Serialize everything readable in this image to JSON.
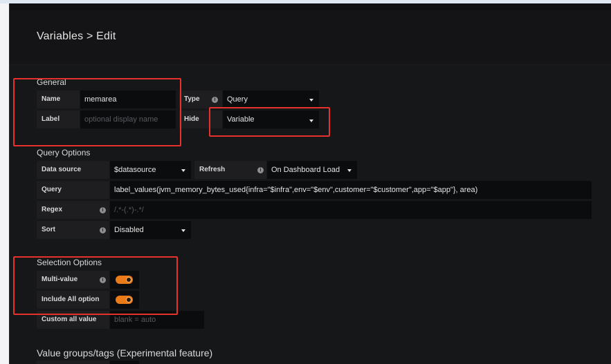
{
  "page": {
    "title": "Variables > Edit"
  },
  "general": {
    "title": "General",
    "name_label": "Name",
    "name_value": "memarea",
    "label_label": "Label",
    "label_placeholder": "optional display name",
    "type_label": "Type",
    "type_value": "Query",
    "hide_label": "Hide",
    "hide_value": "Variable"
  },
  "query_options": {
    "title": "Query Options",
    "datasource_label": "Data source",
    "datasource_value": "$datasource",
    "refresh_label": "Refresh",
    "refresh_value": "On Dashboard Load",
    "query_label": "Query",
    "query_value": "label_values(jvm_memory_bytes_used{infra=\"$infra\",env=\"$env\",customer=\"$customer\",app=\"$app\"}, area)",
    "regex_label": "Regex",
    "regex_placeholder": "/.*-(.*)-.*/",
    "sort_label": "Sort",
    "sort_value": "Disabled"
  },
  "selection_options": {
    "title": "Selection Options",
    "multi_value_label": "Multi-value",
    "multi_value_on": true,
    "include_all_label": "Include All option",
    "include_all_on": true,
    "custom_all_label": "Custom all value",
    "custom_all_placeholder": "blank = auto"
  },
  "value_groups": {
    "title": "Value groups/tags (Experimental feature)"
  },
  "colors": {
    "accent": "#eb7b18",
    "highlight": "#e8312d",
    "background": "#161719"
  },
  "icons": {
    "info": "info-icon",
    "dropdown": "caret-down-icon"
  }
}
